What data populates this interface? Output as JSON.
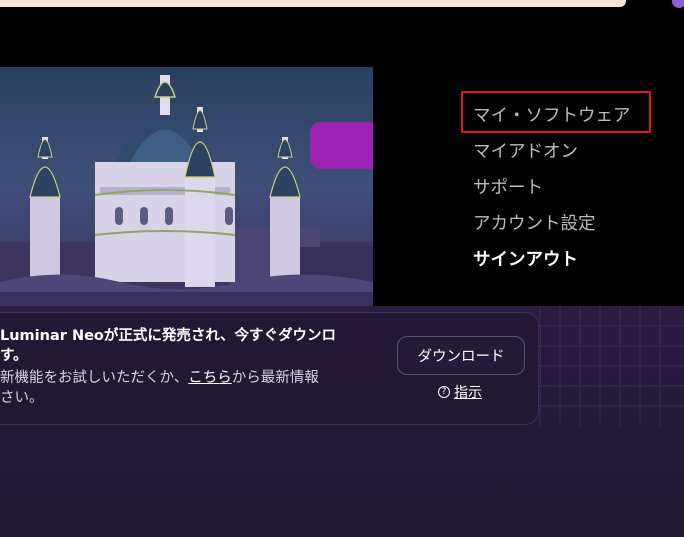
{
  "menu": {
    "items": [
      {
        "label": "マイ・ソフトウェア"
      },
      {
        "label": "マイアドオン"
      },
      {
        "label": "サポート"
      },
      {
        "label": "アカウント設定"
      },
      {
        "label": "サインアウト"
      }
    ]
  },
  "notice": {
    "title_line1": "Luminar Neoが正式に発売され、今すぐダウンロ",
    "title_line2": "す。",
    "body_line1_before": "新機能をお試しいただくか、",
    "body_link": "こちら",
    "body_line1_after": "から最新情報",
    "body_line2": "さい。",
    "download_label": "ダウンロード",
    "help_label": "指示",
    "help_icon": "question-circle-icon"
  },
  "colors": {
    "highlight_border": "#e0161a",
    "purple_tab": "#9c22b4",
    "background": "#000000"
  }
}
